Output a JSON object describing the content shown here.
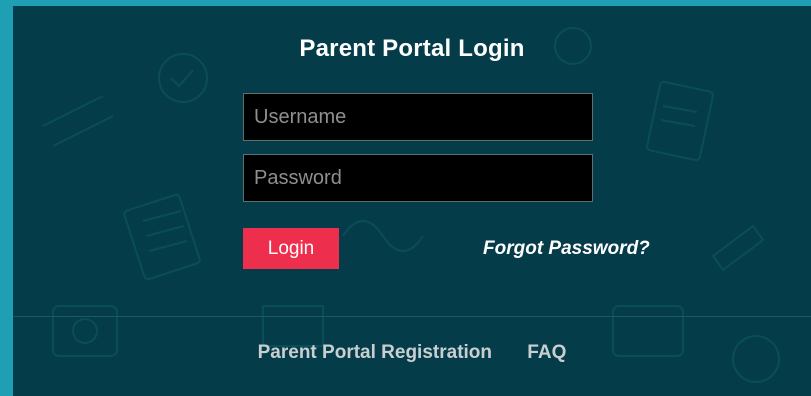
{
  "page": {
    "title": "Parent Portal Login"
  },
  "form": {
    "username": {
      "placeholder": "Username",
      "value": ""
    },
    "password": {
      "placeholder": "Password",
      "value": ""
    },
    "login_label": "Login",
    "forgot_label": "Forgot Password?"
  },
  "footer": {
    "links": [
      {
        "label": "Parent Portal Registration"
      },
      {
        "label": "FAQ"
      }
    ]
  },
  "colors": {
    "outer_background": "#1fa3b8",
    "panel_background": "#053c49",
    "login_button": "#ee2e4d",
    "input_background": "#000000"
  }
}
